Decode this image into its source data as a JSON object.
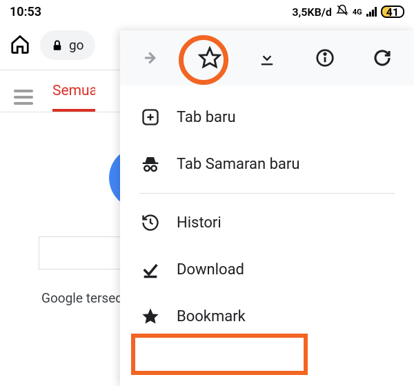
{
  "status": {
    "time": "10:53",
    "data_rate": "3,5KB/d",
    "network_label": "4G",
    "battery": "41"
  },
  "browser": {
    "url_fragment": "go"
  },
  "tabs": {
    "active_label": "Semua"
  },
  "content": {
    "footer": "Google tersed"
  },
  "menu": {
    "items": [
      {
        "label": "Tab baru"
      },
      {
        "label": "Tab Samaran baru"
      },
      {
        "label": "Histori"
      },
      {
        "label": "Download"
      },
      {
        "label": "Bookmark"
      }
    ]
  }
}
